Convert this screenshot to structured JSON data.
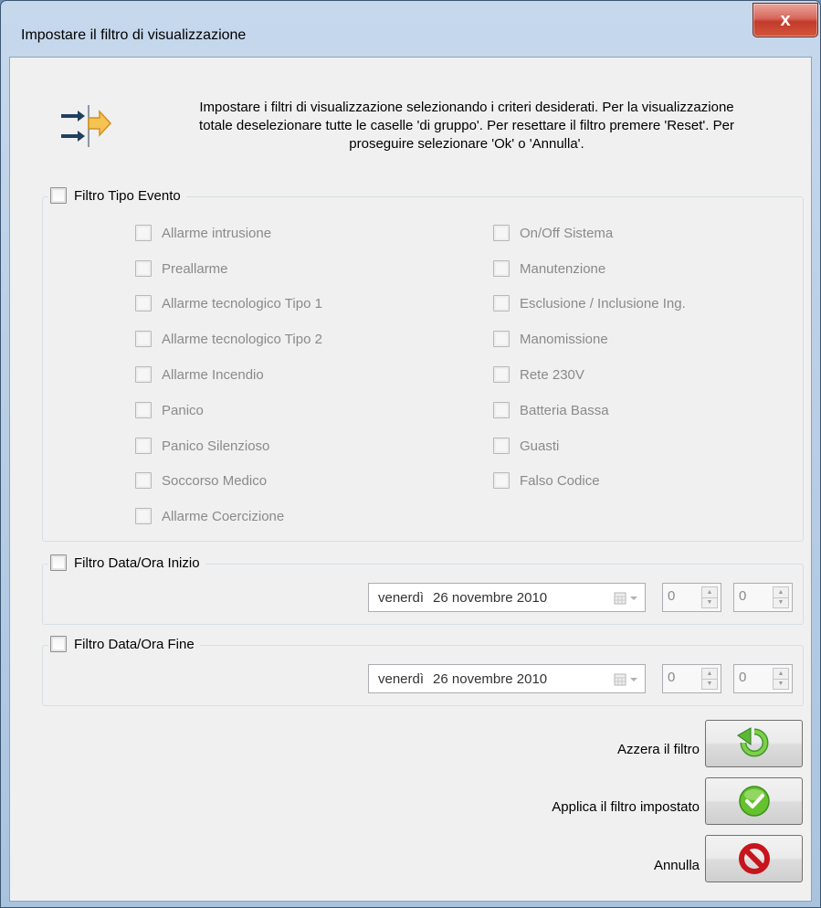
{
  "window": {
    "title": "Impostare il filtro di visualizzazione",
    "close_label": "x"
  },
  "intro": {
    "line1": "Impostare i filtri di visualizzazione selezionando i criteri desiderati. Per la visualizzazione",
    "line2": "totale deselezionare tutte le caselle 'di gruppo'. Per resettare il filtro premere 'Reset'. Per",
    "line3": "proseguire selezionare 'Ok' o 'Annulla'."
  },
  "event_filter": {
    "label": "Filtro Tipo Evento",
    "left_options": [
      "Allarme intrusione",
      "Preallarme",
      "Allarme tecnologico Tipo 1",
      "Allarme tecnologico Tipo 2",
      "Allarme Incendio",
      "Panico",
      "Panico Silenzioso",
      "Soccorso Medico",
      "Allarme Coercizione"
    ],
    "right_options": [
      "On/Off Sistema",
      "Manutenzione",
      "Esclusione / Inclusione Ing.",
      "Manomissione",
      "Rete 230V",
      "Batteria Bassa",
      "Guasti",
      "Falso Codice"
    ]
  },
  "start_filter": {
    "label": "Filtro Data/Ora Inizio",
    "day": "venerdì",
    "date": "26 novembre 2010",
    "hour": "0",
    "minute": "0"
  },
  "end_filter": {
    "label": "Filtro Data/Ora Fine",
    "day": "venerdì",
    "date": "26 novembre 2010",
    "hour": "0",
    "minute": "0"
  },
  "actions": {
    "reset_label": "Azzera il filtro",
    "apply_label": "Applica il filtro impostato",
    "cancel_label": "Annulla"
  },
  "icons": {
    "header": "filter-arrows-icon",
    "reset": "green-refresh-arrow-icon",
    "apply": "green-check-icon",
    "cancel": "red-no-entry-icon"
  }
}
